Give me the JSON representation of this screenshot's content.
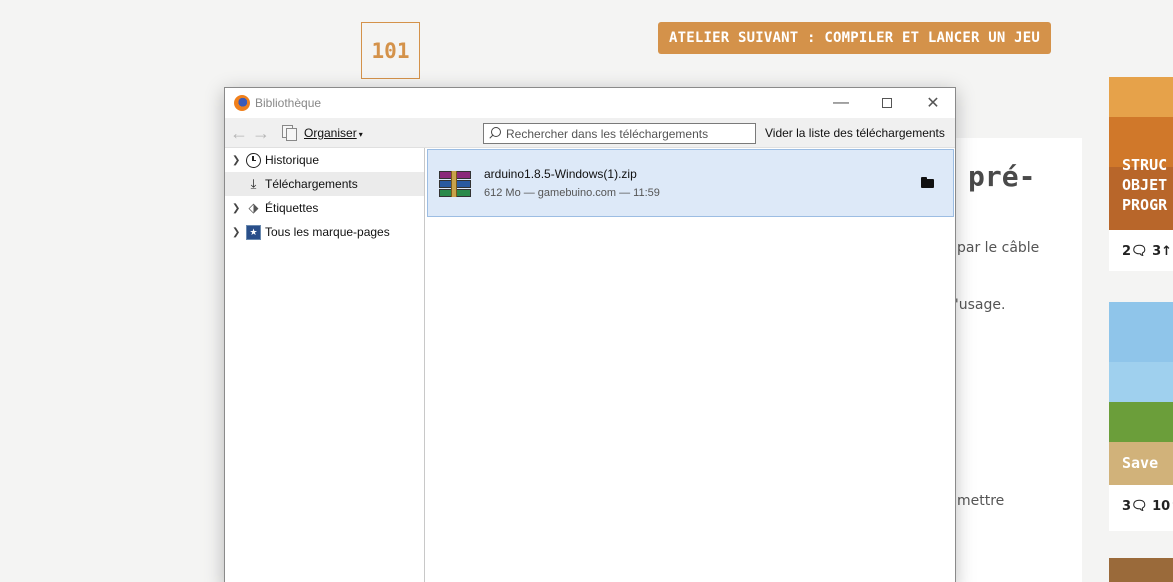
{
  "background": {
    "badge": "101",
    "next_workshop": "ATELIER SUIVANT : COMPILER ET LANCER UN JEU",
    "article_title": "pré-",
    "article_lines": [
      "par le câble",
      "l'usage.",
      "mettre"
    ],
    "cards": [
      {
        "overlay": [
          "STRUC",
          "OBJET",
          "PROGR"
        ],
        "comments": "2",
        "likes": "3"
      },
      {
        "overlay": [
          "Save"
        ],
        "comments": "3",
        "likes": "10"
      }
    ]
  },
  "window": {
    "title": "Bibliothèque",
    "toolbar": {
      "organise_label": "Organiser",
      "search_placeholder": "Rechercher dans les téléchargements",
      "clear_label": "Vider la liste des téléchargements"
    },
    "sidebar": {
      "items": [
        {
          "label": "Historique",
          "icon": "clock-icon",
          "expandable": true,
          "selected": false
        },
        {
          "label": "Téléchargements",
          "icon": "download-icon",
          "expandable": false,
          "selected": true
        },
        {
          "label": "Étiquettes",
          "icon": "tag-icon",
          "expandable": true,
          "selected": false
        },
        {
          "label": "Tous les marque-pages",
          "icon": "bookmarks-icon",
          "expandable": true,
          "selected": false
        }
      ]
    },
    "downloads": [
      {
        "name": "arduino1.8.5-Windows(1).zip",
        "meta": "612 Mo — gamebuino.com — 11:59"
      }
    ]
  },
  "colors": {
    "accent": "#d4924a",
    "selection": "#dde9f8",
    "selection_border": "#9cbde3"
  }
}
